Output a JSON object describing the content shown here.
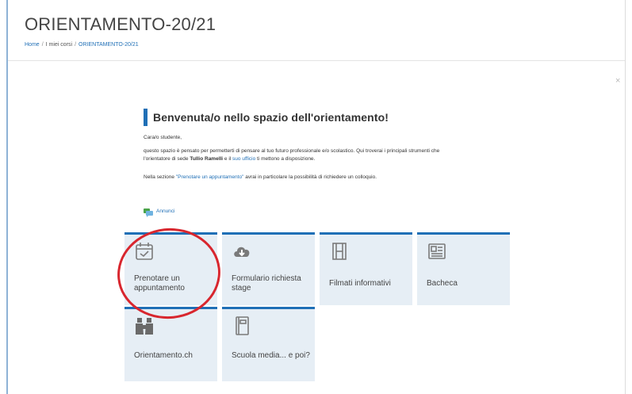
{
  "header": {
    "title": "ORIENTAMENTO-20/21",
    "breadcrumb": [
      "Home",
      "I miei corsi",
      "ORIENTAMENTO-20/21"
    ]
  },
  "welcome": {
    "title": "Benvenuta/o nello spazio dell'orientamento!",
    "greeting": "Cara/o studente,",
    "line1": "questo spazio è pensato per permetterti di pensare al tuo futuro professionale e/o scolastico. Qui troverai i principali strumenti che",
    "line2_prefix": "l'orientatore di sede ",
    "line2_name": "Tullio Ramelli",
    "line2_mid": " e il ",
    "line2_link": "suo ufficio",
    "line2_suffix": " ti mettono a disposizione.",
    "line3_prefix": "Nella sezione ",
    "line3_link": "\"Prenotare un appuntamento\"",
    "line3_suffix": " avrai in particolare la possibilità di richiedere un colloquio."
  },
  "annunci": {
    "label": "Annunci",
    "icon": "forum-icon"
  },
  "tiles": [
    {
      "line1": "Prenotare un",
      "line2": "appuntamento",
      "icon": "calendar-check-icon"
    },
    {
      "line1": "Formulario richiesta",
      "line2": "stage",
      "icon": "cloud-download-icon"
    },
    {
      "line1": "Filmati informativi",
      "line2": "",
      "icon": "film-icon"
    },
    {
      "line1": "Bacheca",
      "line2": "",
      "icon": "newspaper-icon"
    },
    {
      "line1": "Orientamento.ch",
      "line2": "",
      "icon": "binoculars-icon"
    },
    {
      "line1": "Scuola media... e poi?",
      "line2": "",
      "icon": "book-icon"
    }
  ],
  "colors": {
    "accent": "#1f6fb6",
    "tile_bg": "#e6eef5",
    "annotation": "#d8262e"
  }
}
